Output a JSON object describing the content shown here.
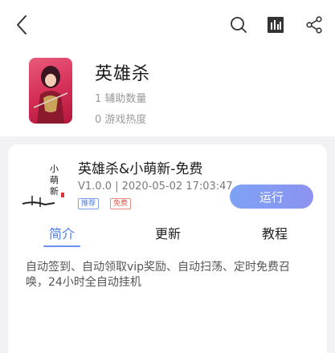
{
  "header": {
    "back_icon": "chevron-left-icon",
    "search_icon": "search-icon",
    "stats_icon": "bar-chart-icon",
    "share_icon": "share-icon"
  },
  "app": {
    "name": "英雄杀",
    "assist_count": "1 辅助数量",
    "game_heat": "0 游戏热度"
  },
  "script": {
    "title": "英雄杀&小萌新-免费",
    "meta": "V1.0.0 | 2020-05-02 17:03:47",
    "tags": [
      "推荐",
      "免费"
    ],
    "run_label": "运行",
    "thumb_text": "小萌新"
  },
  "tabs": [
    {
      "label": "简介",
      "active": true
    },
    {
      "label": "更新",
      "active": false
    },
    {
      "label": "教程",
      "active": false
    }
  ],
  "description": "自动签到、自动领取vip奖励、自动扫荡、定时免费召唤，24小时全自动挂机",
  "colors": {
    "accent": "#4a7ee8",
    "run_button": "#8c93f0",
    "tag_free": "#e05a4a"
  }
}
